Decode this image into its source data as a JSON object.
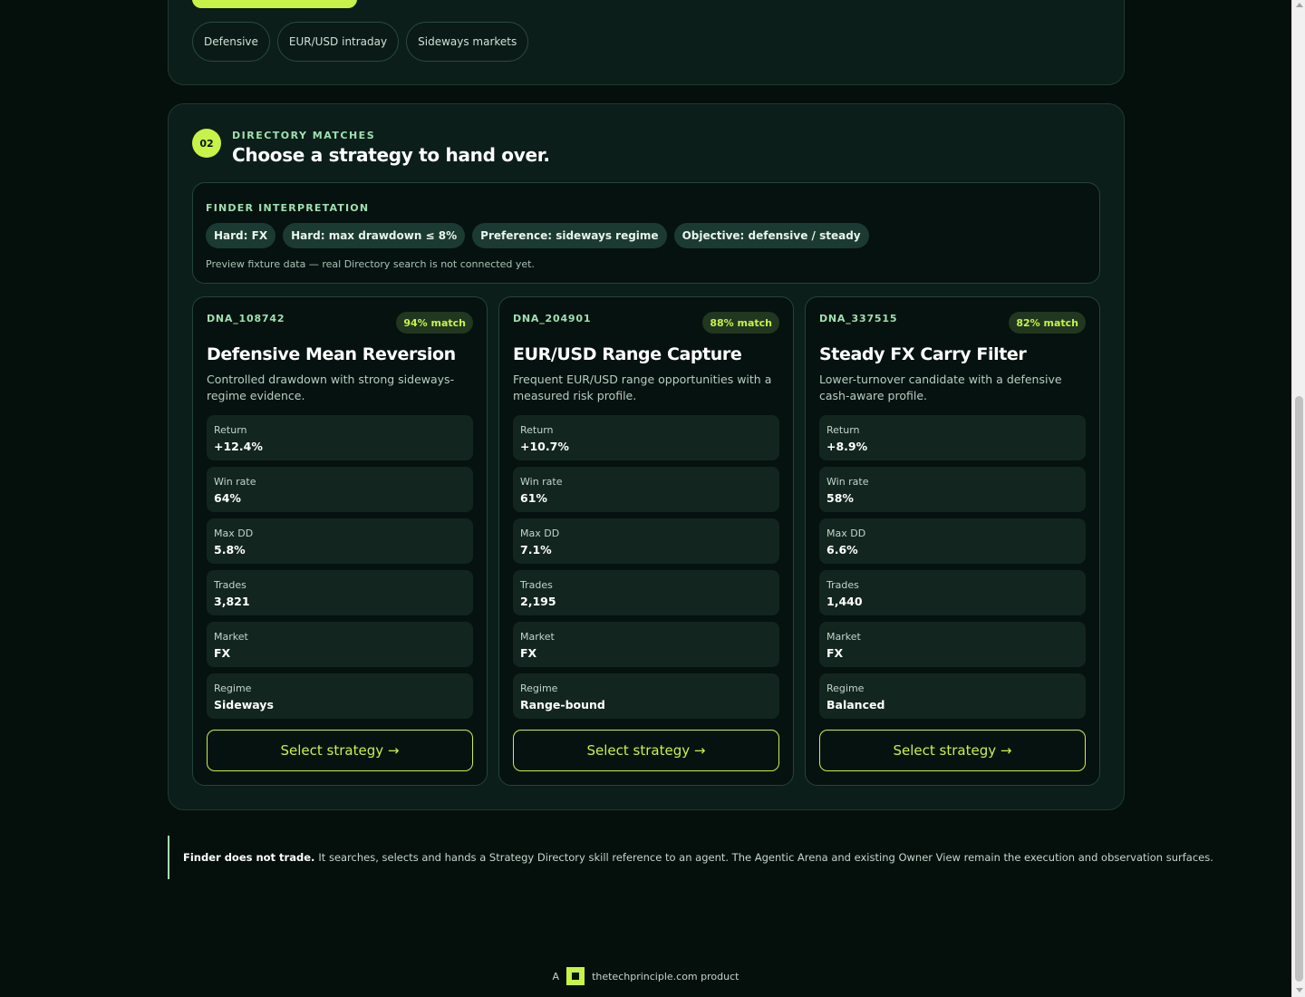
{
  "top": {
    "chips": [
      "Defensive",
      "EUR/USD intraday",
      "Sideways markets"
    ]
  },
  "matches": {
    "step": "02",
    "eyebrow": "DIRECTORY MATCHES",
    "title": "Choose a strategy to hand over.",
    "interpretation": {
      "label": "FINDER INTERPRETATION",
      "tags": [
        "Hard: FX",
        "Hard: max drawdown ≤ 8%",
        "Preference: sideways regime",
        "Objective: defensive / steady"
      ],
      "note": "Preview fixture data — real Directory search is not connected yet."
    },
    "cards": [
      {
        "id": "DNA_108742",
        "match": "94% match",
        "title": "Defensive Mean Reversion",
        "desc": "Controlled drawdown with strong sideways-regime evidence.",
        "metrics": [
          {
            "label": "Return",
            "value": "+12.4%"
          },
          {
            "label": "Win rate",
            "value": "64%"
          },
          {
            "label": "Max DD",
            "value": "5.8%"
          },
          {
            "label": "Trades",
            "value": "3,821"
          },
          {
            "label": "Market",
            "value": "FX"
          },
          {
            "label": "Regime",
            "value": "Sideways"
          }
        ],
        "cta": "Select strategy →"
      },
      {
        "id": "DNA_204901",
        "match": "88% match",
        "title": "EUR/USD Range Capture",
        "desc": "Frequent EUR/USD range opportunities with a measured risk profile.",
        "metrics": [
          {
            "label": "Return",
            "value": "+10.7%"
          },
          {
            "label": "Win rate",
            "value": "61%"
          },
          {
            "label": "Max DD",
            "value": "7.1%"
          },
          {
            "label": "Trades",
            "value": "2,195"
          },
          {
            "label": "Market",
            "value": "FX"
          },
          {
            "label": "Regime",
            "value": "Range-bound"
          }
        ],
        "cta": "Select strategy →"
      },
      {
        "id": "DNA_337515",
        "match": "82% match",
        "title": "Steady FX Carry Filter",
        "desc": "Lower-turnover candidate with a defensive cash-aware profile.",
        "metrics": [
          {
            "label": "Return",
            "value": "+8.9%"
          },
          {
            "label": "Win rate",
            "value": "58%"
          },
          {
            "label": "Max DD",
            "value": "6.6%"
          },
          {
            "label": "Trades",
            "value": "1,440"
          },
          {
            "label": "Market",
            "value": "FX"
          },
          {
            "label": "Regime",
            "value": "Balanced"
          }
        ],
        "cta": "Select strategy →"
      }
    ]
  },
  "notice": {
    "strong": "Finder does not trade.",
    "text": "It searches, selects and hands a Strategy Directory skill reference to an agent. The Agentic Arena and existing Owner View remain the execution and observation surfaces."
  },
  "footer": {
    "prefix": "A",
    "brand": "thetechprinciple.com product"
  },
  "colors": {
    "accent": "#c6f24a",
    "eyebrow": "#9fe0b0",
    "background": "#050f0c",
    "panel": "#0c1e19"
  }
}
